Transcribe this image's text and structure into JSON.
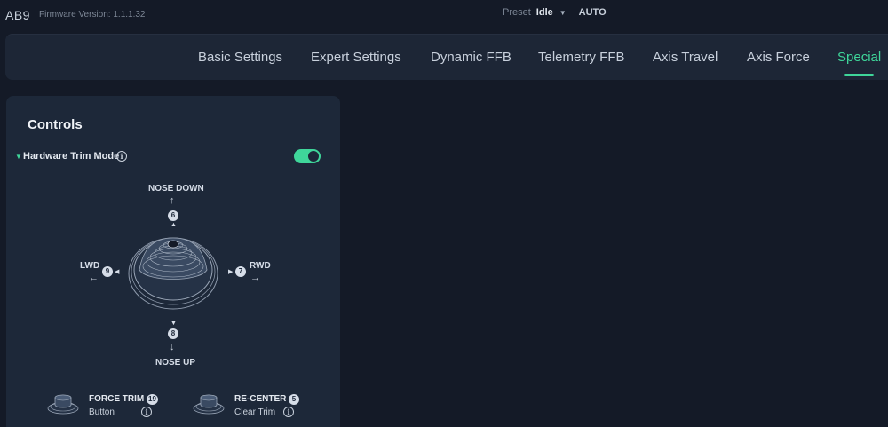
{
  "app": {
    "name": "AB9",
    "firmware": "Firmware Version: 1.1.1.32"
  },
  "preset": {
    "label": "Preset",
    "value": "Idle",
    "mode": "AUTO"
  },
  "tabs": [
    "Basic Settings",
    "Expert Settings",
    "Dynamic FFB",
    "Telemetry FFB",
    "Axis Travel",
    "Axis Force",
    "Special"
  ],
  "active_tab": "Special",
  "panel": {
    "title": "Controls",
    "section": "Hardware Trim Mode",
    "toggle_on": true
  },
  "trim": {
    "up": {
      "label": "NOSE DOWN",
      "arrow": "↑",
      "number": "6"
    },
    "down": {
      "label": "NOSE UP",
      "arrow": "↓",
      "number": "8"
    },
    "left": {
      "label": "LWD",
      "arrow": "←",
      "number": "9"
    },
    "right": {
      "label": "RWD",
      "arrow": "→",
      "number": "7"
    }
  },
  "buttons": [
    {
      "title": "FORCE TRIM",
      "number": "19",
      "sub": "Button"
    },
    {
      "title": "RE-CENTER",
      "number": "5",
      "sub": "Clear Trim"
    }
  ],
  "colors": {
    "accent": "#3fd69a",
    "background": "#141a27",
    "panel": "#1d2839"
  }
}
